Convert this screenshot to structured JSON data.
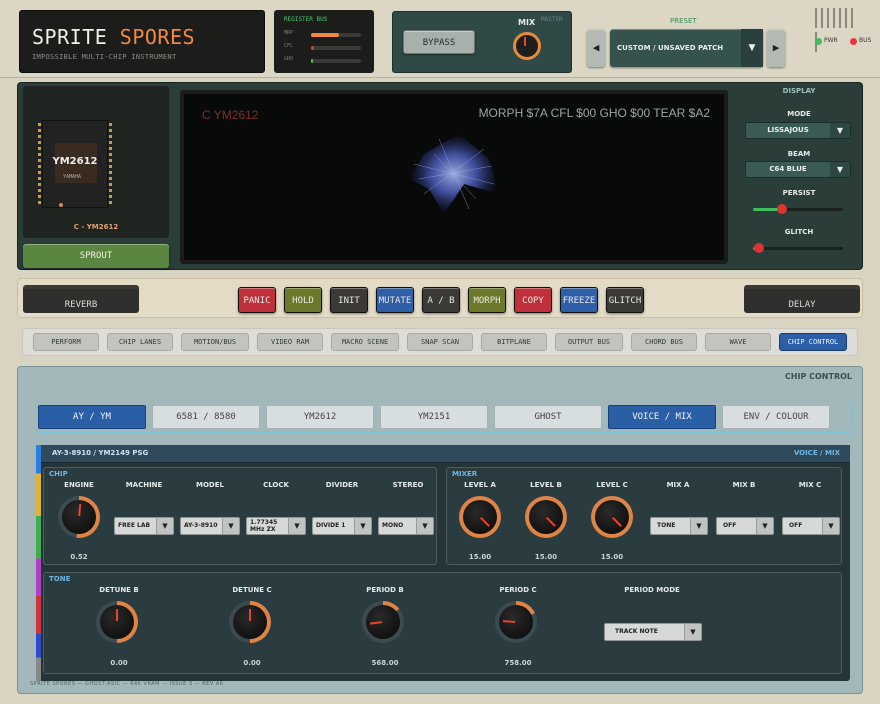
{
  "header": {
    "logo_title_a": "SPRITE",
    "logo_title_b": "SPORES",
    "logo_subtitle": "IMPOSSIBLE MULTI-CHIP INSTRUMENT",
    "register_bus_label": "REGISTER BUS",
    "register_bus": [
      {
        "label": "MRP",
        "level": 0.55,
        "color": "#f08a40"
      },
      {
        "label": "CFL",
        "level": 0.06,
        "color": "#e33b3b"
      },
      {
        "label": "GHO",
        "level": 0.04,
        "color": "#3fbf5e"
      }
    ],
    "bypass_label": "BYPASS",
    "mix_label": "MIX",
    "mix_sub_label": "MASTER",
    "mix_level": 0.5,
    "preset_label": "PRESET",
    "preset_value": "CUSTOM / UNSAVED PATCH",
    "pwr_label": "PWR",
    "bus_label": "BUS",
    "pwr_color": "#3fbf5e",
    "bus_color": "#e33b3b"
  },
  "chip_view": {
    "chip_name": "YM2612",
    "chip_maker": "YAMAHA",
    "chip_label": "C - YM2612",
    "sprout_label": "SPROUT"
  },
  "scope": {
    "left_text": "C YM2612",
    "right_text": "MORPH $7A  CFL $00  GHO $00  TEAR $A2"
  },
  "display": {
    "title": "DISPLAY",
    "mode_label": "MODE",
    "mode_value": "LISSAJOUS",
    "beam_label": "BEAM",
    "beam_value": "C64 BLUE",
    "persist_label": "PERSIST",
    "persist_level": 0.32,
    "glitch_label": "GLITCH",
    "glitch_level": 0.07
  },
  "fx": {
    "reverb": "REVERB",
    "delay": "DELAY",
    "buttons": [
      {
        "label": "PANIC",
        "color": "#c0303a"
      },
      {
        "label": "HOLD",
        "color": "#6a7a2a"
      },
      {
        "label": "INIT",
        "color": "#3b3a36"
      },
      {
        "label": "MUTATE",
        "color": "#2f5fa8"
      },
      {
        "label": "A / B",
        "color": "#3b3a36"
      },
      {
        "label": "MORPH",
        "color": "#6a7a2a"
      },
      {
        "label": "COPY",
        "color": "#c0303a"
      },
      {
        "label": "FREEZE",
        "color": "#2f5fa8"
      },
      {
        "label": "GLITCH",
        "color": "#3b3a36"
      }
    ]
  },
  "tabs": [
    "PERFORM",
    "CHIP LANES",
    "MOTION/BUS",
    "VIDEO RAM",
    "MACRO SCENE",
    "SNAP SCAN",
    "BITPLANE",
    "OUTPUT BUS",
    "CHORD BUS",
    "WAVE",
    "CHIP CONTROL"
  ],
  "active_tab": "CHIP CONTROL",
  "chip_control": {
    "title": "CHIP CONTROL",
    "subtabs": [
      "AY / YM",
      "6581 / 8580",
      "YM2612",
      "YM2151",
      "GHOST",
      "VOICE / MIX",
      "ENV / COLOUR"
    ],
    "active_subtabs": [
      "AY / YM",
      "VOICE / MIX"
    ],
    "panel_title": "AY-3-8910 / YM2149 PSG",
    "panel_mode": "VOICE / MIX",
    "chip_section": "CHIP",
    "mixer_section": "MIXER",
    "tone_section": "TONE",
    "engine": {
      "label": "ENGINE",
      "value": "0.52",
      "level": 0.52
    },
    "machine": {
      "label": "MACHINE",
      "value": "FREE LAB"
    },
    "model": {
      "label": "MODEL",
      "value": "AY-3-8910"
    },
    "clock": {
      "label": "CLOCK",
      "value": "1.77345 MHz ZX"
    },
    "divider": {
      "label": "DIVIDER",
      "value": "DIVIDE 1"
    },
    "stereo": {
      "label": "STEREO",
      "value": "MONO"
    },
    "levels": [
      {
        "label": "LEVEL A",
        "value": "15.00",
        "level": 1.0
      },
      {
        "label": "LEVEL B",
        "value": "15.00",
        "level": 1.0
      },
      {
        "label": "LEVEL C",
        "value": "15.00",
        "level": 1.0
      }
    ],
    "mixes": [
      {
        "label": "MIX A",
        "value": "TONE"
      },
      {
        "label": "MIX B",
        "value": "OFF"
      },
      {
        "label": "MIX C",
        "value": "OFF"
      }
    ],
    "tone_knobs": [
      {
        "label": "DETUNE B",
        "value": "0.00",
        "level": 0.5
      },
      {
        "label": "DETUNE C",
        "value": "0.00",
        "level": 0.5
      },
      {
        "label": "PERIOD B",
        "value": "568.00",
        "level": 0.14
      },
      {
        "label": "PERIOD C",
        "value": "758.00",
        "level": 0.18
      }
    ],
    "period_mode": {
      "label": "PERIOD MODE",
      "value": "TRACK NOTE"
    }
  },
  "footer": "SPRITE SPORES — GHOST-ASIC — 64K VRAM — ISSUE 3 — REV A6"
}
